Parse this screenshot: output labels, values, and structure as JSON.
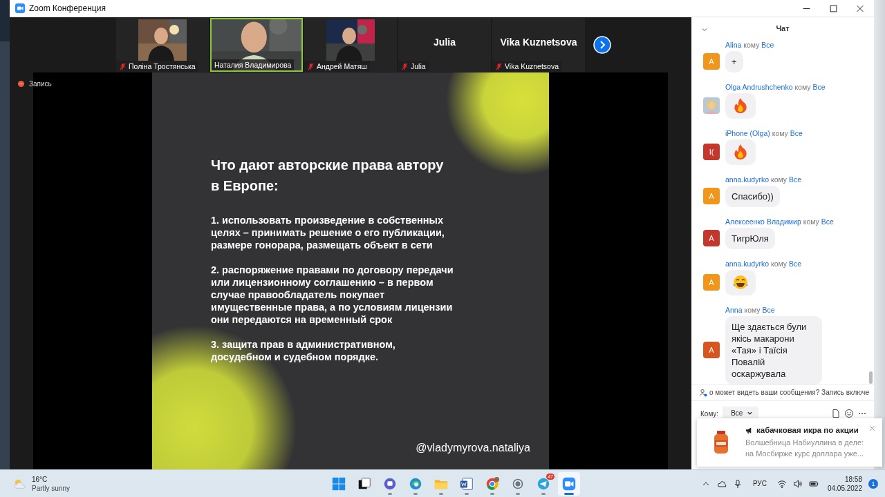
{
  "window": {
    "title": "Zoom Конференция"
  },
  "participants": [
    {
      "name": "Поліна Тростянська",
      "kind": "video",
      "muted": true,
      "speaking": false
    },
    {
      "name": "Наталия Владимирова",
      "kind": "video",
      "muted": false,
      "speaking": true
    },
    {
      "name": "Андрей Матяш",
      "kind": "video",
      "muted": true,
      "speaking": false
    },
    {
      "name": "Julia",
      "kind": "name",
      "display_name": "Julia",
      "muted": true,
      "speaking": false
    },
    {
      "name": "Vika Kuznetsova",
      "kind": "name",
      "display_name": "Vika Kuznetsova",
      "muted": true,
      "speaking": false
    }
  ],
  "recording": {
    "label": "Запись"
  },
  "slide": {
    "title_lines": [
      "Что дают авторские права автору",
      "в Европе:"
    ],
    "paragraphs": [
      [
        "1. использовать произведение в собственных",
        "целях – принимать решение о его публикации,",
        "размере гонорара, размещать объект в сети"
      ],
      [
        "2. распоряжение правами по договору передачи",
        "или лицензионному соглашению – в первом",
        "случае правообладатель покупает",
        "имущественные права, а по условиям лицензии",
        "они передаются на временный срок"
      ],
      [
        "3. защита прав в административном,",
        "досудебном и судебном порядке."
      ]
    ],
    "handle": "@vladymyrova.nataliya"
  },
  "chat": {
    "title": "Чат",
    "messages": [
      {
        "sender": "Alina",
        "to_word": "кому",
        "recipient": "Все",
        "avatar": {
          "kind": "letter",
          "letter": "A",
          "color": "#f0961b"
        },
        "kind": "text",
        "text": "+"
      },
      {
        "sender": "Olga Andrushchenko",
        "to_word": "кому",
        "recipient": "Все",
        "kind": "fire"
      },
      {
        "sender": "iPhone (Olga)",
        "to_word": "кому",
        "recipient": "Все",
        "avatar": {
          "kind": "letter",
          "letter": "I(",
          "color": "#c4372c"
        },
        "kind": "fire"
      },
      {
        "sender": "anna.kudyrko",
        "to_word": "кому",
        "recipient": "Все",
        "avatar": {
          "kind": "letter",
          "letter": "A",
          "color": "#f0961b"
        },
        "kind": "text",
        "text": "Спасибо))"
      },
      {
        "sender": "Алексеенко Владимир",
        "to_word": "кому",
        "recipient": "Все",
        "avatar": {
          "kind": "letter",
          "letter": "A",
          "color": "#c4372c"
        },
        "kind": "text",
        "text": "ТигрЮля"
      },
      {
        "sender": "anna.kudyrko",
        "to_word": "кому",
        "recipient": "Все",
        "avatar": {
          "kind": "letter",
          "letter": "A",
          "color": "#f0961b"
        },
        "kind": "laugh"
      },
      {
        "sender": "Anna",
        "to_word": "кому",
        "recipient": "Все",
        "avatar": {
          "kind": "letter",
          "letter": "A",
          "color": "#d9541e"
        },
        "kind": "text",
        "text": "Ще здається були якісь макарони «Тая» і Таїсія Повалій оскаржувала"
      }
    ],
    "privacy_notice": "о может видеть ваши сообщения? Запись включе",
    "to_label": "Кому:",
    "recipient": "Все"
  },
  "notification": {
    "title": "кабачковая икра по акции",
    "body_lines": [
      "Волшебница Набиуллина в деле:",
      "на Мосбирже курс доллара уже..."
    ]
  },
  "taskbar": {
    "temperature": "16°C",
    "weather": "Partly sunny",
    "apps": [
      {
        "kind": "windows",
        "running": false,
        "active": false
      },
      {
        "kind": "taskview",
        "running": false,
        "active": false
      },
      {
        "kind": "teams",
        "running": true,
        "active": false
      },
      {
        "kind": "edge",
        "running": true,
        "active": false
      },
      {
        "kind": "folder",
        "running": true,
        "active": false
      },
      {
        "kind": "word",
        "running": true,
        "active": false
      },
      {
        "kind": "chrome",
        "running": true,
        "active": false
      },
      {
        "kind": "settings",
        "running": true,
        "active": false
      },
      {
        "kind": "telegram",
        "running": true,
        "active": false,
        "badge": "47"
      },
      {
        "kind": "zoom",
        "running": true,
        "active": true
      }
    ],
    "language": "РУС",
    "time": "18:58",
    "date": "04.05.2022",
    "notifications": "1"
  }
}
